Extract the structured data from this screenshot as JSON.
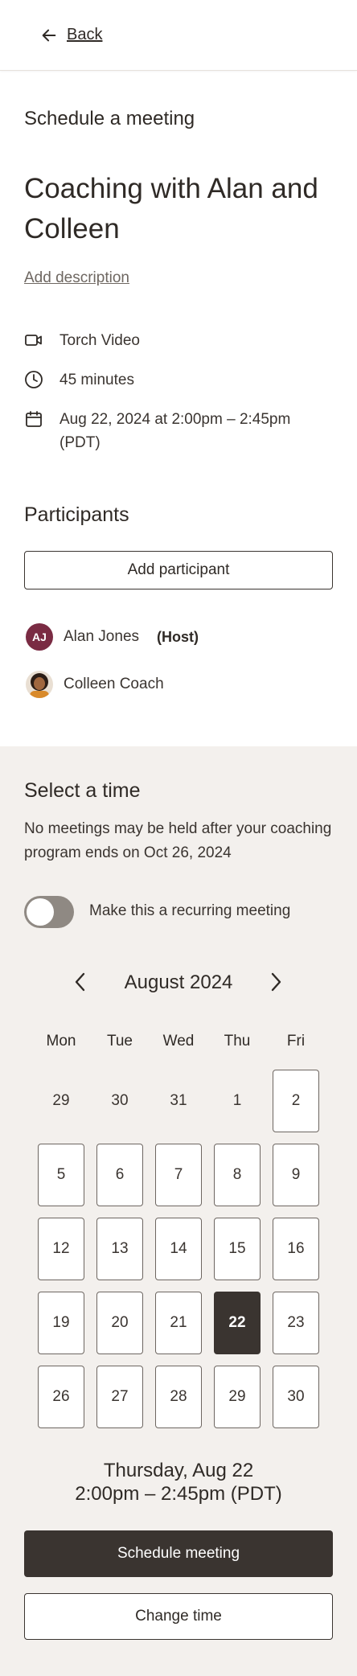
{
  "header": {
    "back_label": "Back"
  },
  "page": {
    "eyebrow": "Schedule a meeting",
    "title": "Coaching with Alan and Colleen",
    "add_description": "Add description"
  },
  "details": {
    "location": "Torch Video",
    "duration": "45 minutes",
    "datetime": "Aug 22, 2024 at 2:00pm – 2:45pm (PDT)"
  },
  "participants": {
    "heading": "Participants",
    "add_label": "Add participant",
    "people": [
      {
        "initials": "AJ",
        "name": "Alan Jones",
        "tag": "(Host)",
        "avatar_color": "#7a2b43"
      },
      {
        "initials": "",
        "name": "Colleen Coach",
        "tag": "",
        "avatar_color": "#b8732e"
      }
    ]
  },
  "time_select": {
    "heading": "Select a time",
    "info": "No meetings may be held after your coaching program ends on Oct 26, 2024",
    "recurring_label": "Make this a recurring meeting",
    "recurring_on": false
  },
  "calendar": {
    "month": "August 2024",
    "weekdays": [
      "Mon",
      "Tue",
      "Wed",
      "Thu",
      "Fri"
    ],
    "weeks": [
      [
        "29",
        "30",
        "31",
        "1",
        "2"
      ],
      [
        "5",
        "6",
        "7",
        "8",
        "9"
      ],
      [
        "12",
        "13",
        "14",
        "15",
        "16"
      ],
      [
        "19",
        "20",
        "21",
        "22",
        "23"
      ],
      [
        "26",
        "27",
        "28",
        "29",
        "30"
      ]
    ],
    "available_first_row": [
      false,
      false,
      false,
      false,
      true
    ],
    "selected": "22"
  },
  "summary": {
    "date": "Thursday, Aug 22",
    "time": "2:00pm – 2:45pm (PDT)"
  },
  "actions": {
    "schedule_label": "Schedule meeting",
    "change_label": "Change time"
  },
  "colors": {
    "primary_dark": "#3a3430",
    "panel_bg": "#f3f0ed",
    "host_avatar": "#7a2b43"
  }
}
